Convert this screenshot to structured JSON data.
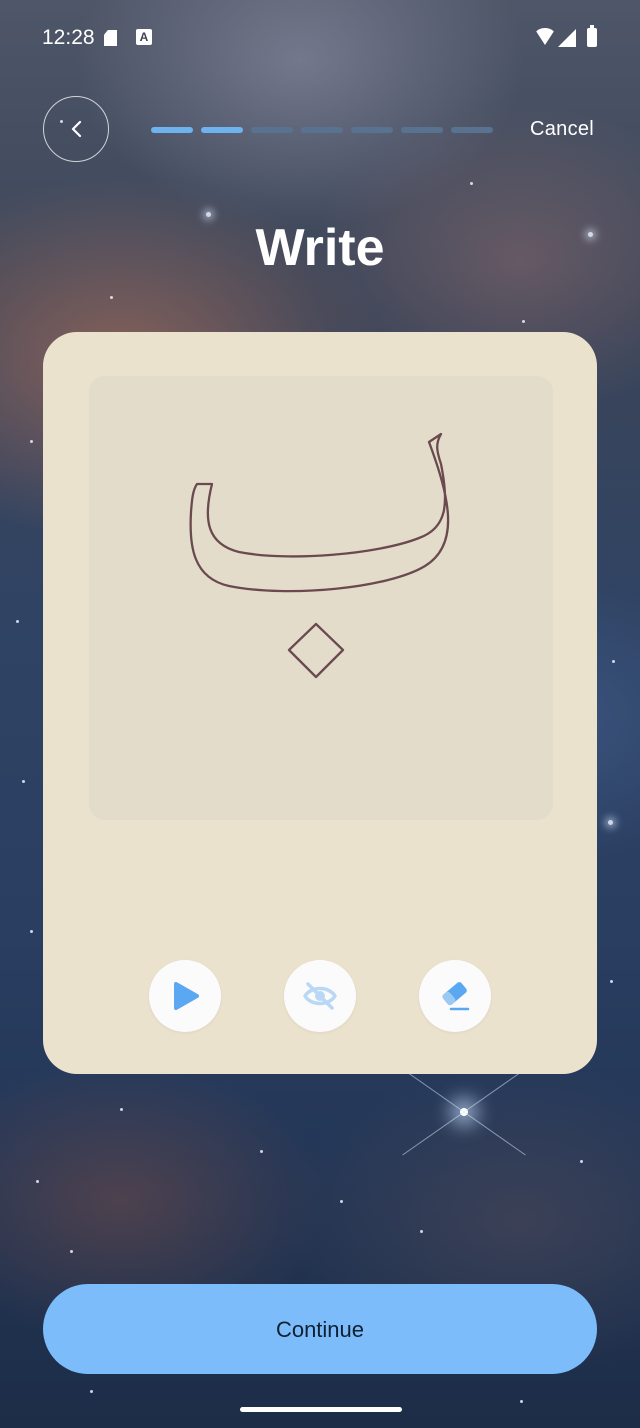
{
  "status_bar": {
    "time": "12:28",
    "icons": [
      "sd-card-icon",
      "a-icon",
      "wifi-icon",
      "signal-icon",
      "battery-icon"
    ]
  },
  "header": {
    "back_icon": "chevron-left-icon",
    "cancel_label": "Cancel",
    "progress": {
      "completed_steps": 2,
      "total_steps": 7
    },
    "progress_active_color": "#6fb3ee",
    "progress_inactive_color": "#58728f"
  },
  "page": {
    "title": "Write"
  },
  "card": {
    "letter": "ب",
    "letter_outline_color": "#6b4a4f",
    "card_color": "#ebe2ce",
    "canvas_color": "#e3dccb",
    "tools": [
      {
        "name": "play-button",
        "icon": "play-icon"
      },
      {
        "name": "hide-guide-button",
        "icon": "eye-off-icon"
      },
      {
        "name": "eraser-button",
        "icon": "eraser-icon"
      }
    ]
  },
  "footer": {
    "continue_label": "Continue",
    "continue_color": "#7cbcfa"
  },
  "accent_color": "#5aa7f2"
}
